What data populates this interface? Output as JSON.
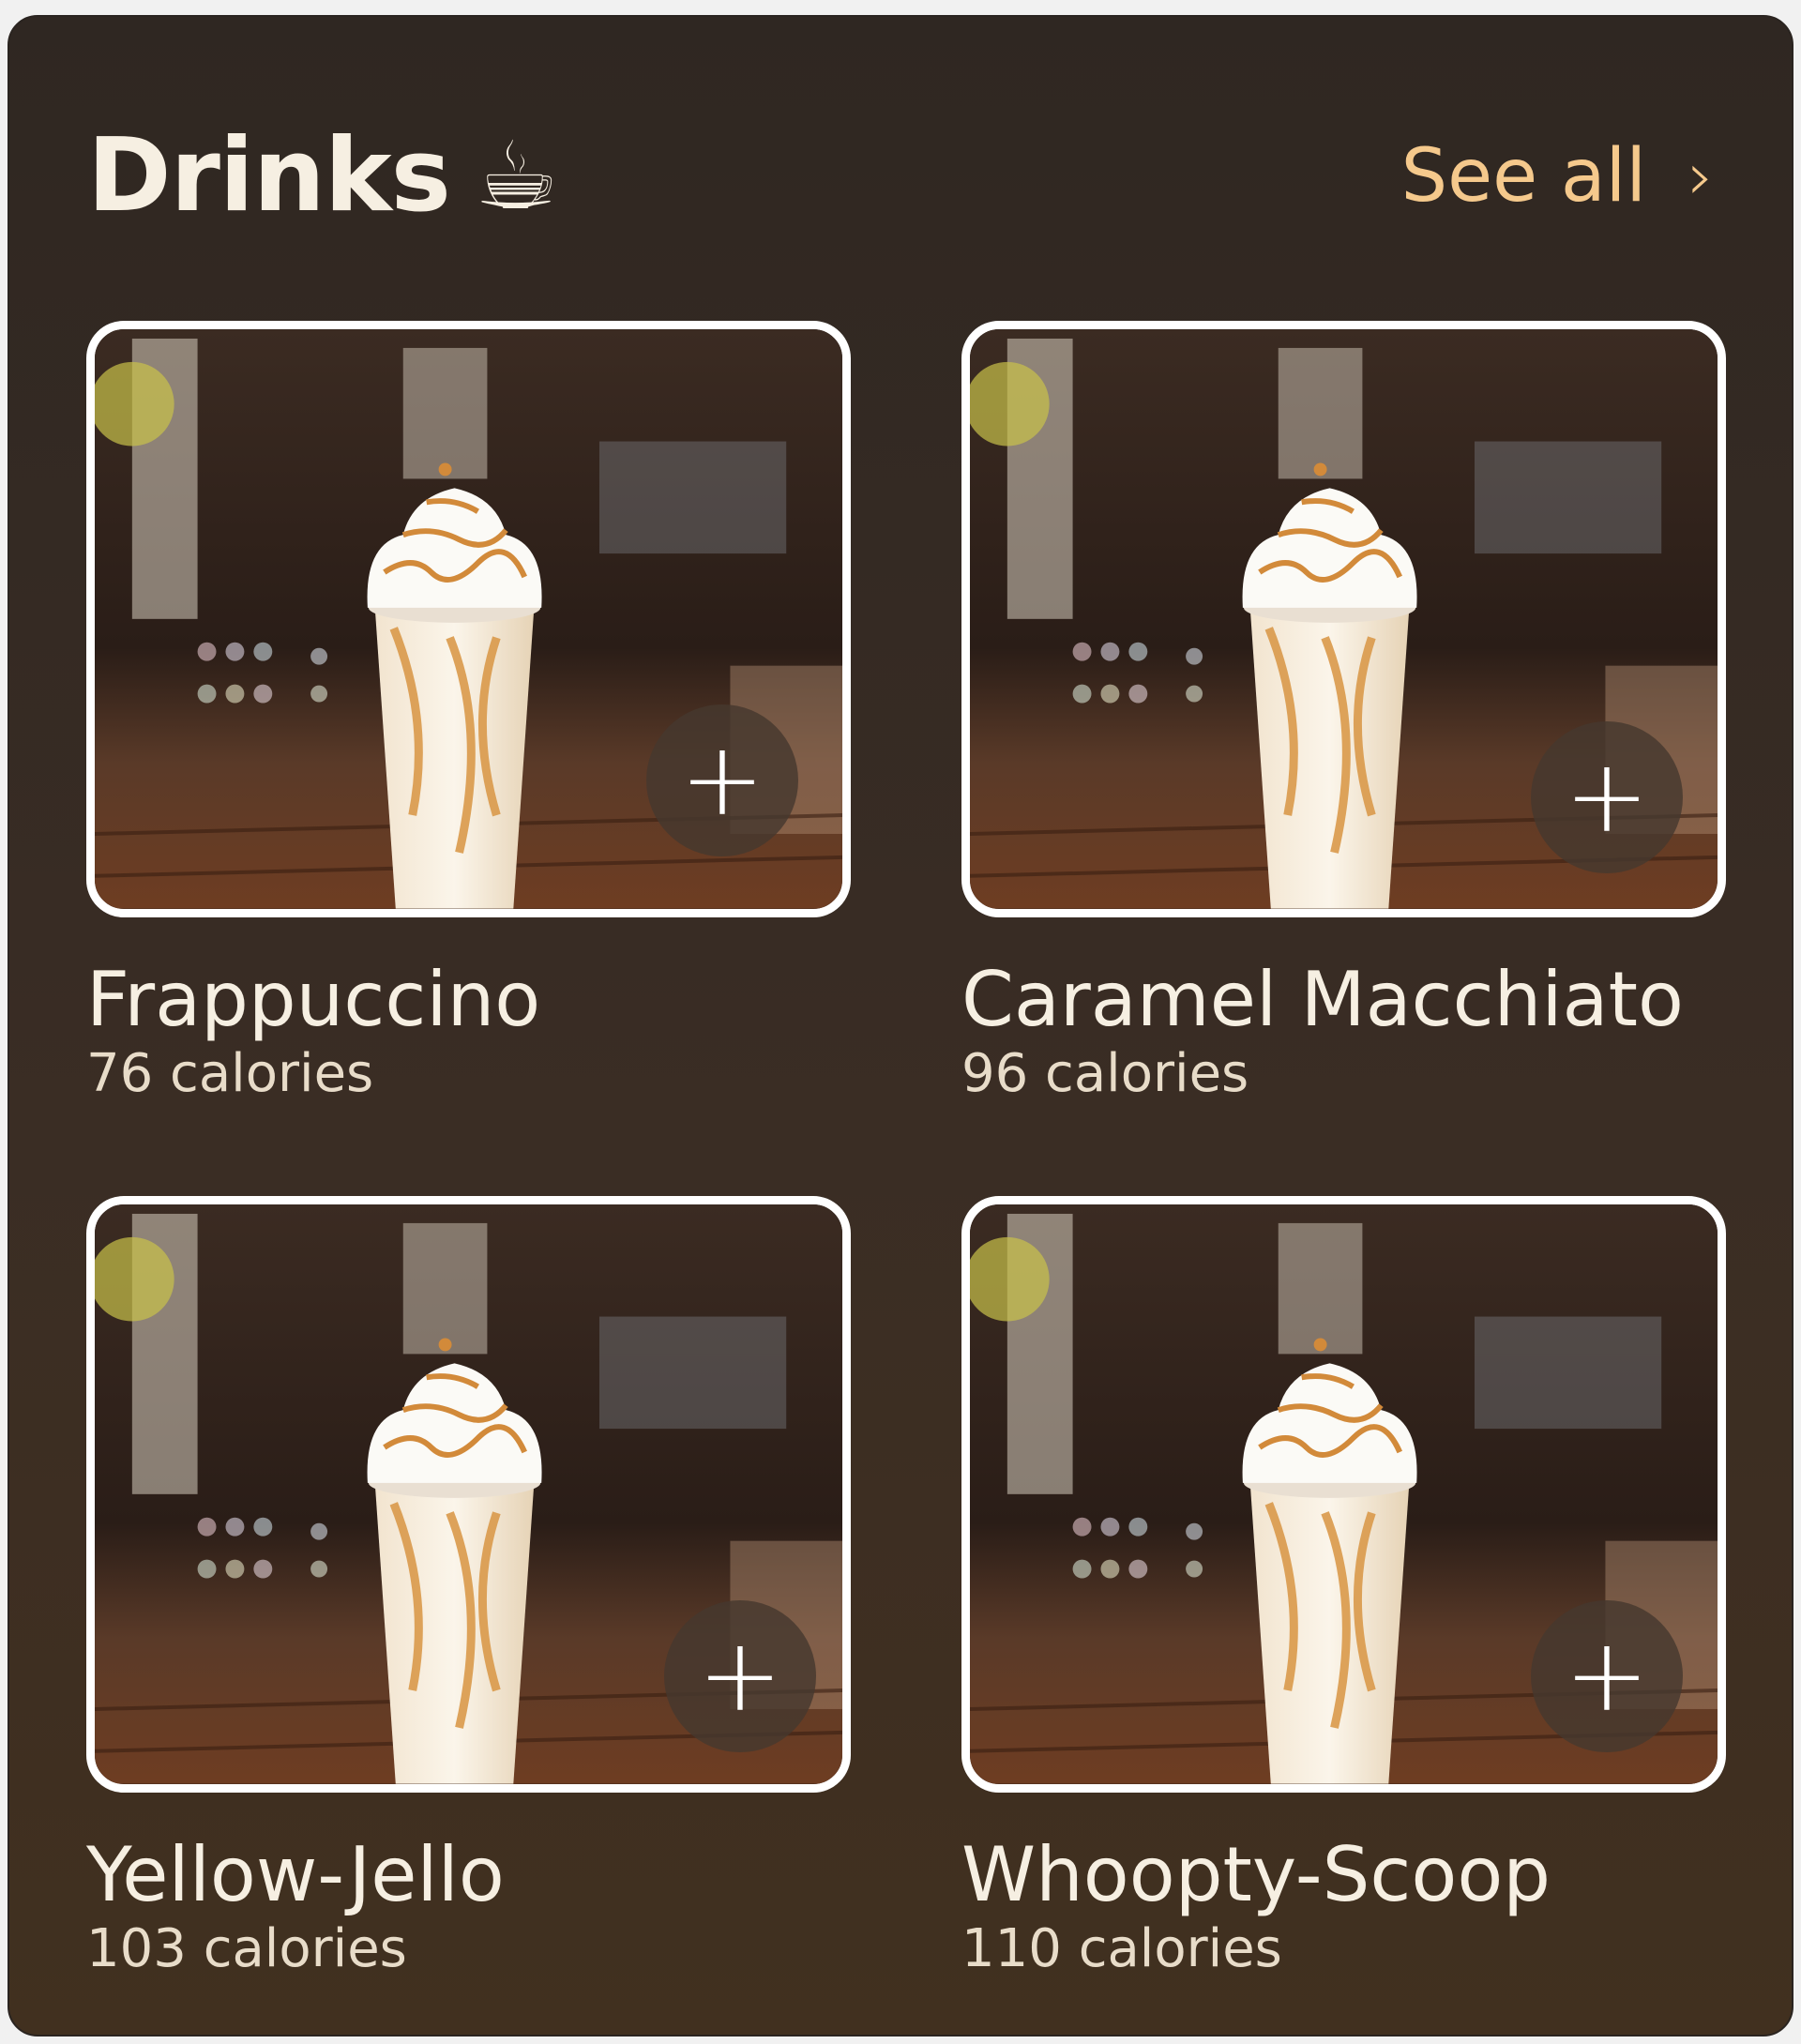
{
  "header": {
    "title": "Drinks",
    "title_emoji": "☕",
    "see_all_label": "See all",
    "see_all_icon": "›"
  },
  "drinks": [
    {
      "name": "Frappuccino",
      "calories": "76 calories",
      "add_icon": "+"
    },
    {
      "name": "Caramel Macchiato",
      "calories": "96 calories",
      "add_icon": "+"
    },
    {
      "name": "Yellow-Jello",
      "calories": "103 calories",
      "add_icon": "+"
    },
    {
      "name": "Whoopty-Scoop",
      "calories": "110 calories",
      "add_icon": "+"
    }
  ],
  "colors": {
    "background": "#3a2d24",
    "accent": "#f5c98c",
    "text": "#f6efe2"
  }
}
